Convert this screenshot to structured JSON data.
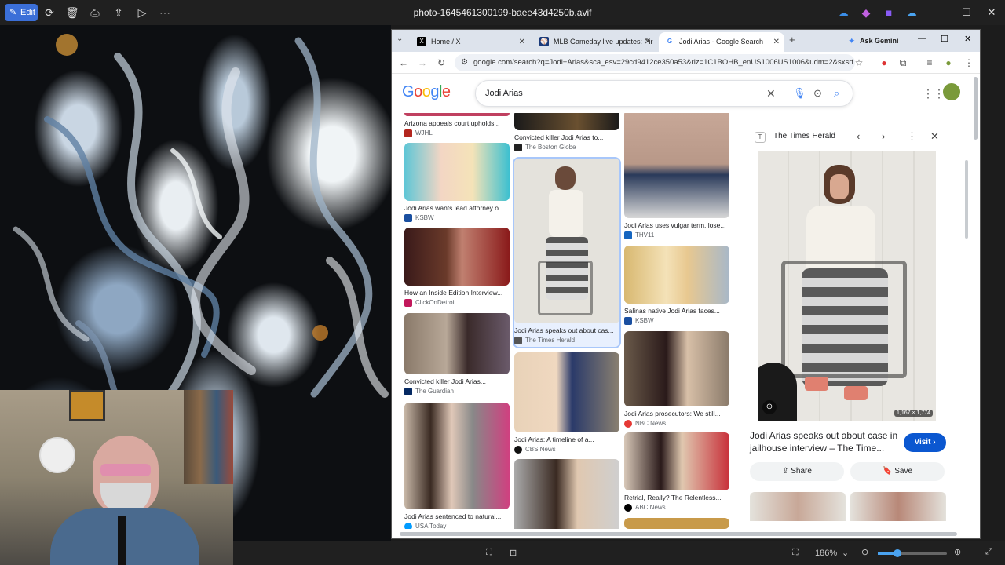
{
  "viewer": {
    "edit_label": "Edit",
    "title": "photo-1645461300199-baee43d4250b.avif",
    "zoom": "186%"
  },
  "browser": {
    "tabs": [
      {
        "label": "Home / X"
      },
      {
        "label": "MLB Gameday live updates: Pir"
      },
      {
        "label": "Jodi Arias - Google Search"
      }
    ],
    "gemini_label": "Ask Gemini",
    "url": "google.com/search?q=Jodi+Arias&sca_esv=29cd9412ce350a53&rlz=1C1BOHB_enUS1006US1006&udm=2&sxsrf...",
    "search_query": "Jodi Arias"
  },
  "results": {
    "col1": [
      {
        "caption": "Arizona appeals court upholds...",
        "source": "WJHL",
        "fav_color": "#b3261e"
      },
      {
        "caption": "Jodi Arias wants lead attorney o...",
        "source": "KSBW",
        "fav_color": "#1a4fa0"
      },
      {
        "caption": "How an Inside Edition Interview...",
        "source": "ClickOnDetroit",
        "fav_color": "#c2185b"
      },
      {
        "caption": "Convicted killer Jodi Arias...",
        "source": "The Guardian",
        "fav_color": "#052962"
      },
      {
        "caption": "Jodi Arias sentenced to natural...",
        "source": "USA Today",
        "fav_color": "#009bff"
      }
    ],
    "col2": [
      {
        "caption": "Convicted killer Jodi Arias to...",
        "source": "The Boston Globe",
        "fav_color": "#222222"
      },
      {
        "caption": "Jodi Arias speaks out about cas...",
        "source": "The Times Herald",
        "fav_color": "#555555"
      },
      {
        "caption": "Jodi Arias: A timeline of a...",
        "source": "CBS News",
        "fav_color": "#111111"
      }
    ],
    "col3": [
      {
        "caption": "Jodi Arias uses vulgar term, lose...",
        "source": "THV11",
        "fav_color": "#1565c0"
      },
      {
        "caption": "Salinas native Jodi Arias faces...",
        "source": "KSBW",
        "fav_color": "#1a4fa0"
      },
      {
        "caption": "Jodi Arias prosecutors: We still...",
        "source": "NBC News",
        "fav_color": "#e53935"
      },
      {
        "caption": "Retrial, Really? The Relentless...",
        "source": "ABC News",
        "fav_color": "#000000"
      }
    ]
  },
  "panel": {
    "source": "The Times Herald",
    "image_size": "1,167 × 1,774",
    "title": "Jodi Arias speaks out about case in jailhouse interview – The Time...",
    "visit_label": "Visit",
    "share_label": "Share",
    "save_label": "Save"
  },
  "colors": {
    "google_blue": "#4285f4",
    "google_red": "#ea4335",
    "google_yellow": "#fbbc05",
    "google_green": "#34a853",
    "visit_button": "#0b57d0"
  }
}
